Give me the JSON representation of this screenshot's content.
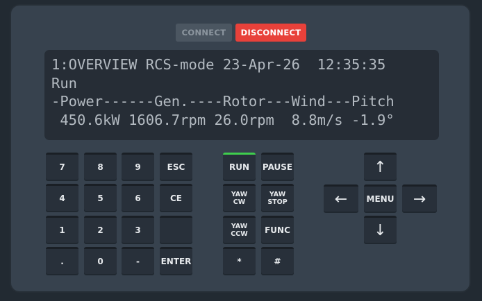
{
  "connection": {
    "connect_label": "CONNECT",
    "disconnect_label": "DISCONNECT"
  },
  "display": {
    "lines": [
      "1:OVERVIEW RCS-mode 23-Apr-26  12:35:35",
      "Run",
      "-Power------Gen.----Rotor---Wind---Pitch",
      " 450.6kW 1606.7rpm 26.0rpm  8.8m/s -1.9°"
    ]
  },
  "numpad": {
    "k7": "7",
    "k8": "8",
    "k9": "9",
    "esc": "ESC",
    "k4": "4",
    "k5": "5",
    "k6": "6",
    "ce": "CE",
    "k1": "1",
    "k2": "2",
    "k3": "3",
    "blank": "",
    "dot": ".",
    "k0": "0",
    "minus": "-",
    "enter": "ENTER"
  },
  "control": {
    "run": "RUN",
    "pause": "PAUSE",
    "yaw_cw": [
      "YAW",
      "CW"
    ],
    "yaw_stop": [
      "YAW",
      "STOP"
    ],
    "yaw_ccw": [
      "YAW",
      "CCW"
    ],
    "func": "FUNC",
    "star": "*",
    "hash": "#"
  },
  "nav": {
    "up": "↑",
    "left": "←",
    "menu": "MENU",
    "right": "→",
    "down": "↓"
  },
  "colors": {
    "run_indicator": "#3fcf4d",
    "disconnect": "#e8413a"
  }
}
